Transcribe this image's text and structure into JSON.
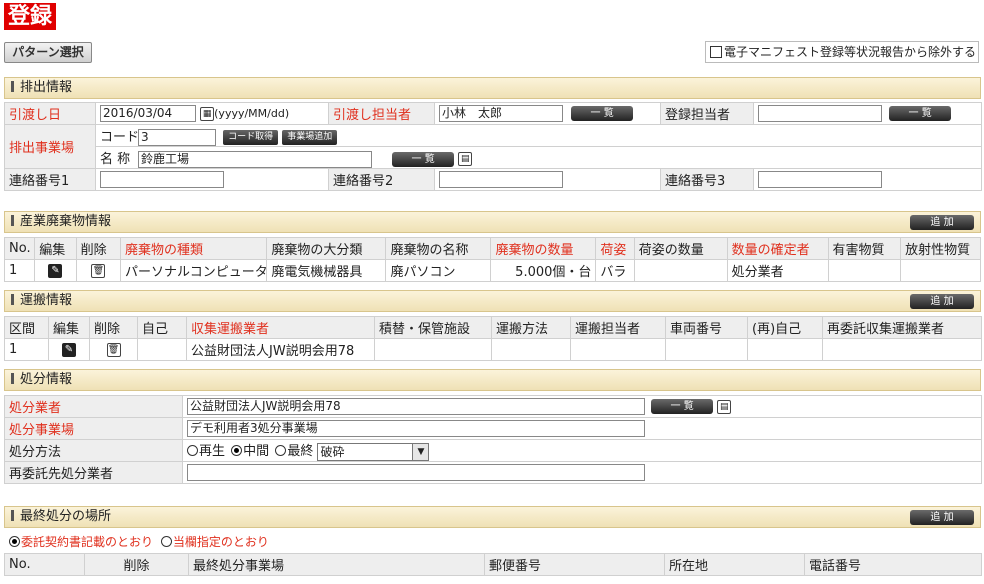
{
  "page": {
    "title": "登録",
    "pattern_button": "パターン選択",
    "exclude_label": "電子マニフェスト登録等状況報告から除外する"
  },
  "common": {
    "list_button": "一 覧",
    "add_button": "追 加"
  },
  "emission": {
    "section_title": "排出情報",
    "handover_date_label": "引渡し日",
    "handover_date_value": "2016/03/04",
    "date_format": "(yyyy/MM/dd)",
    "handover_person_label": "引渡し担当者",
    "handover_person_value": "小林　太郎",
    "registrant_label": "登録担当者",
    "registrant_value": "",
    "site_label": "排出事業場",
    "code_label": "コード",
    "code_value": "3",
    "code_fetch_button": "コード取得",
    "site_add_button": "事業場追加",
    "name_label": "名 称",
    "name_value": "鈴鹿工場",
    "contact1_label": "連絡番号1",
    "contact1_value": "",
    "contact2_label": "連絡番号2",
    "contact2_value": "",
    "contact3_label": "連絡番号3",
    "contact3_value": ""
  },
  "waste": {
    "section_title": "産業廃棄物情報",
    "columns": [
      "No.",
      "編集",
      "削除",
      "廃棄物の種類",
      "廃棄物の大分類",
      "廃棄物の名称",
      "廃棄物の数量",
      "荷姿",
      "荷姿の数量",
      "数量の確定者",
      "有害物質",
      "放射性物質"
    ],
    "rows": [
      {
        "no": "1",
        "type": "パーソナルコンピュータ",
        "category": "廃電気機械器具",
        "name": "廃パソコン",
        "quantity": "5.000個・台",
        "packing": "バラ",
        "packing_qty": "",
        "confirmer": "処分業者",
        "hazardous": "",
        "radioactive": ""
      }
    ]
  },
  "transport": {
    "section_title": "運搬情報",
    "columns": [
      "区間",
      "編集",
      "削除",
      "自己",
      "収集運搬業者",
      "積替・保管施設",
      "運搬方法",
      "運搬担当者",
      "車両番号",
      "(再)自己",
      "再委託収集運搬業者"
    ],
    "rows": [
      {
        "section": "1",
        "self": "",
        "carrier": "公益財団法人JW説明会用78",
        "transfer": "",
        "method": "",
        "person": "",
        "vehicle": "",
        "re_self": "",
        "re_carrier": ""
      }
    ]
  },
  "disposal": {
    "section_title": "処分情報",
    "contractor_label": "処分業者",
    "contractor_value": "公益財団法人JW説明会用78",
    "site_label": "処分事業場",
    "site_value": "デモ利用者3処分事業場",
    "method_label": "処分方法",
    "method_options": [
      "再生",
      "中間",
      "最終"
    ],
    "method_selected": "中間",
    "method_detail": "破砕",
    "subcontract_label": "再委託先処分業者",
    "subcontract_value": ""
  },
  "final": {
    "section_title": "最終処分の場所",
    "option_contract": "委託契約書記載のとおり",
    "option_field": "当欄指定のとおり",
    "columns": [
      "No.",
      "削除",
      "最終処分事業場",
      "郵便番号",
      "所在地",
      "電話番号"
    ]
  }
}
